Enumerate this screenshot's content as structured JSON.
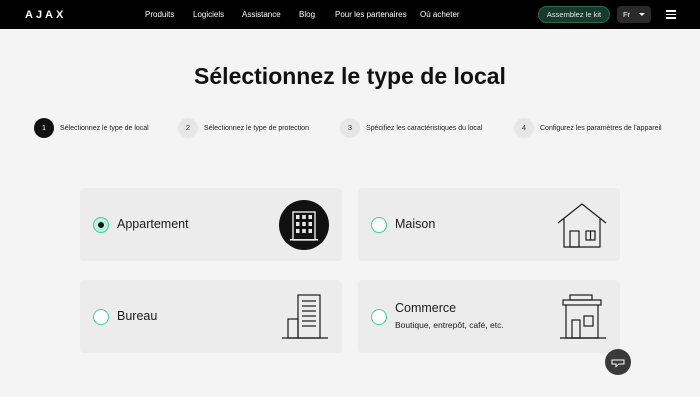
{
  "header": {
    "logo": "AJAX",
    "nav": [
      "Produits",
      "Logiciels",
      "Assistance",
      "Blog",
      "Pour les partenaires",
      "Où acheter"
    ],
    "kit_button": "Assemblez le kit",
    "language": "Fr"
  },
  "page_title": "Sélectionnez le type de local",
  "steps": [
    {
      "number": "1",
      "label": "Sélectionnez le type de local",
      "active": true
    },
    {
      "number": "2",
      "label": "Sélectionnez le type de protection",
      "active": false
    },
    {
      "number": "3",
      "label": "Spécifiez les caractéristiques du local",
      "active": false
    },
    {
      "number": "4",
      "label": "Configurez les paramètres de l'appareil",
      "active": false
    }
  ],
  "options": [
    {
      "label": "Appartement",
      "subtitle": "",
      "selected": true,
      "icon": "apartment-building-icon"
    },
    {
      "label": "Maison",
      "subtitle": "",
      "selected": false,
      "icon": "house-icon"
    },
    {
      "label": "Bureau",
      "subtitle": "",
      "selected": false,
      "icon": "office-building-icon"
    },
    {
      "label": "Commerce",
      "subtitle": "Boutique, entrepôt, café, etc.",
      "selected": false,
      "icon": "shop-icon"
    }
  ],
  "colors": {
    "accent": "#3ad19a",
    "header_bg": "#000000",
    "card_bg": "#ececec"
  }
}
